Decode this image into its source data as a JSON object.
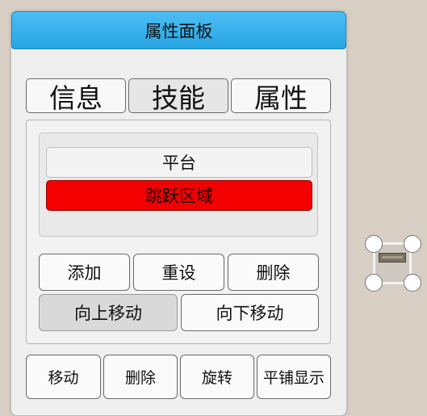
{
  "panel": {
    "title": "属性面板"
  },
  "tabs": [
    {
      "label": "信息"
    },
    {
      "label": "技能"
    },
    {
      "label": "属性"
    }
  ],
  "list": {
    "items": [
      {
        "label": "平台",
        "selected": false
      },
      {
        "label": "跳跃区域",
        "selected": true
      }
    ],
    "selected_color": "#f50000"
  },
  "actions": {
    "add_label": "添加",
    "reset_label": "重设",
    "delete_label": "删除",
    "move_up_label": "向上移动",
    "move_down_label": "向下移动"
  },
  "toolbar": {
    "move_label": "移动",
    "delete_label": "删除",
    "rotate_label": "旋转",
    "tile_label": "平铺显示"
  },
  "colors": {
    "header": "#27a5e3",
    "canvas_background": "#d8cfc4"
  }
}
